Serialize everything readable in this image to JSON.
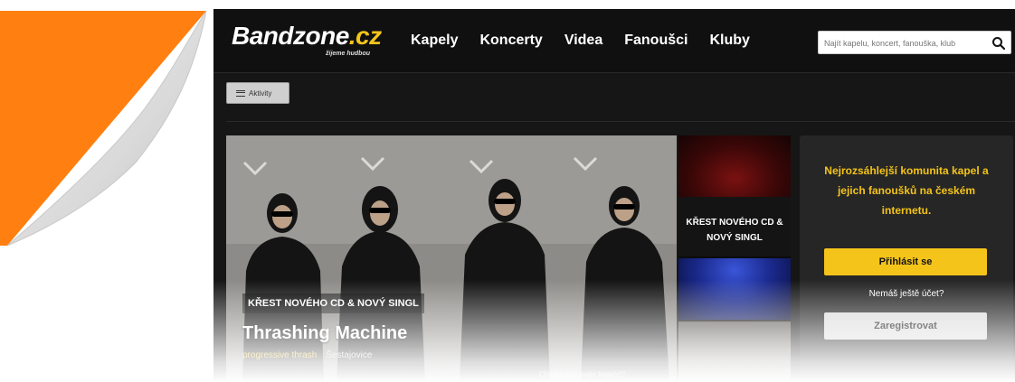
{
  "header": {
    "logo_main": "Bandzone",
    "logo_domain": ".cz",
    "logo_tagline": "žijeme hudbou",
    "nav": [
      "Kapely",
      "Koncerty",
      "Videa",
      "Fanoušci",
      "Kluby"
    ],
    "search_placeholder": "Najít kapelu, koncert, fanouška, klub"
  },
  "toolbar": {
    "activity_label": "Aktivity"
  },
  "hero": {
    "tag": "KŘEST NOVÉHO CD & NOVÝ SINGL",
    "band": "Thrashing Machine",
    "genre": "progressive thrash",
    "location": "Šestajovice",
    "more_link": "Chvalte nás svoje kapely!!!"
  },
  "side": {
    "caption": "KŘEST NOVÉHO CD & NOVÝ SINGL"
  },
  "panel": {
    "promo": "Nejrozsáhlejší komunita kapel a jejich fanoušků na českém internetu.",
    "login_label": "Přihlásit se",
    "no_account": "Nemáš ještě účet?",
    "register_label": "Zaregistrovat"
  },
  "colors": {
    "accent": "#f4c41a",
    "curl": "#ff7f10",
    "background": "#161616"
  }
}
